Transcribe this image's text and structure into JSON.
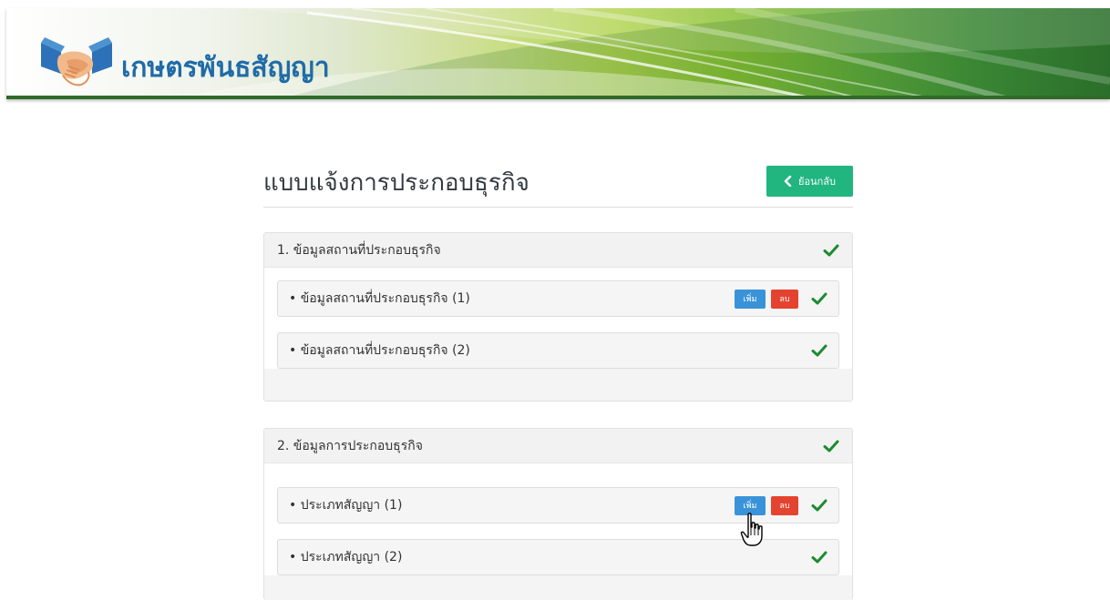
{
  "header": {
    "brand_title": "เกษตรพันธสัญญา",
    "colors": {
      "brand_text": "#1f6ba8",
      "banner_green": "#3e8c38"
    }
  },
  "page": {
    "title": "แบบแจ้งการประกอบธุรกิจ",
    "back_label": "ย้อนกลับ"
  },
  "sections": [
    {
      "title": "1. ข้อมูลสถานที่ประกอบธุรกิจ",
      "complete": true,
      "items": [
        {
          "label": "• ข้อมูลสถานที่ประกอบธุรกิจ (1)",
          "add_label": "เพิ่ม",
          "delete_label": "ลบ",
          "complete": true
        },
        {
          "label": "• ข้อมูลสถานที่ประกอบธุรกิจ (2)",
          "complete": true
        }
      ]
    },
    {
      "title": "2. ข้อมูลการประกอบธุรกิจ",
      "complete": true,
      "items": [
        {
          "label": "• ประเภทสัญญา (1)",
          "add_label": "เพิ่ม",
          "delete_label": "ลบ",
          "complete": true
        },
        {
          "label": "• ประเภทสัญญา (2)",
          "complete": true
        }
      ]
    }
  ],
  "colors": {
    "back_button": "#21b57f",
    "add_button": "#3a93d8",
    "delete_button": "#e4432f",
    "check": "#1e8a2f"
  },
  "icons": {
    "logo": "handshake-logo",
    "back": "chevron-left-icon",
    "check": "check-icon",
    "cursor": "hand-pointer-cursor"
  }
}
